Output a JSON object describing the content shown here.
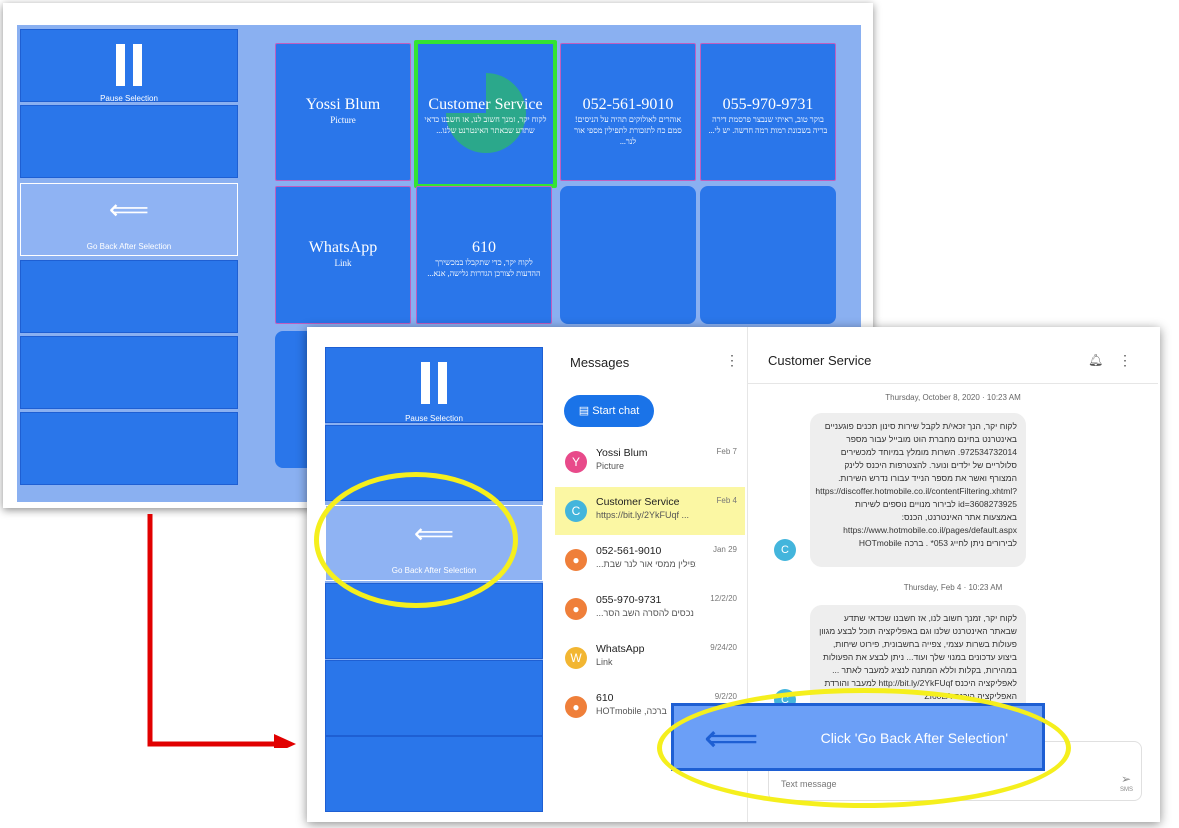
{
  "window1": {
    "sidebar": {
      "pause_label": "Pause Selection",
      "goback_label": "Go Back After Selection"
    },
    "tiles": [
      {
        "title": "Yossi Blum",
        "sub": "Picture",
        "heb": ""
      },
      {
        "title": "Customer Service",
        "sub": "",
        "heb": "לקוח יקר, זמנך חשוב לנו, אז חשבנו כדאי שתדע שבאתר האינטרנט שלנו..."
      },
      {
        "title": "052-561-9010",
        "sub": "",
        "heb": "אוהרים לאולוקים תהיה על הניסים! סמם כח לתזכורת לתפילין מספי אור לנר..."
      },
      {
        "title": "055-970-9731",
        "sub": "",
        "heb": "בוקר טוב, ראיתי שנבצר פרסמת דירה בריה בשכונת רמות רמה חדשה. יש לי..."
      },
      {
        "title": "WhatsApp",
        "sub": "Link",
        "heb": ""
      },
      {
        "title": "610",
        "sub": "",
        "heb": "לקוח יקר, כדי שתקבלו במכשירך ההדעות לצורכן הגדרות גלישה, אנא..."
      }
    ]
  },
  "window2": {
    "sidebar": {
      "pause_label": "Pause Selection",
      "goback_label": "Go Back After Selection"
    },
    "messages": {
      "header": "Messages",
      "start_chat": "Start chat",
      "rows": [
        {
          "initial": "Y",
          "name": "Yossi Blum",
          "preview": "Picture",
          "date": "Feb 7",
          "color": "#e84a8a"
        },
        {
          "initial": "C",
          "name": "Customer Service",
          "preview": "https://bit.ly/2YkFUqf ...",
          "date": "Feb 4",
          "color": "#43b5dc"
        },
        {
          "initial": "",
          "name": "052-561-9010",
          "preview": "...תפילין ממסי אור לנר שבת",
          "date": "Jan 29",
          "color": "#ef7f3a"
        },
        {
          "initial": "",
          "name": "055-970-9731",
          "preview": "...נכסים להסרה השב הסר",
          "date": "12/2/20",
          "color": "#ef7f3a"
        },
        {
          "initial": "W",
          "name": "WhatsApp",
          "preview": "Link",
          "date": "9/24/20",
          "color": "#f2b632"
        },
        {
          "initial": "",
          "name": "610",
          "preview": "HOTmobile ,ברכה",
          "date": "9/2/20",
          "color": "#ef7f3a"
        }
      ]
    },
    "conversation": {
      "title": "Customer Service",
      "timestamp1": "Thursday, October 8, 2020 · 10:23 AM",
      "bubble1": "לקוח יקר, הנך זכאי/ת לקבל שירות סינון תכנים פוגעניים באינטרנט בחינם מחברת הוט מובייל עבור מספר 972534732014. השרות מומלץ במיוחד למכשירים סלולריים של ילדים ונוער. להצטרפות היכנס ללינק המצורף ואשר את מספר הנייד עבורו נדרש השירות. https://discoffer.hotmobile.co.il/contentFiltering.xhtml?id=3608273925 לבירור מנויים נוספים לשירות באמצעות אתר האינטרנט, הכנס: https://www.hotmobile.co.il/pages/default.aspx לבירורים ניתן לחייג 053* . ברכה HOTmobile",
      "timestamp2": "Thursday, Feb 4 · 10:23 AM",
      "bubble2": "לקוח יקר, זמנך חשוב לנו, אז חשבנו שכדאי שתדע שבאתר האינטרנט שלנו וגם באפליקציה תוכל לבצע מגוון פעולות בשרות עצמי, צפייה בחשבונית, פירוט שיחות, ביצוע עדכונים במנוי שלך ועוד... ניתן לבצע את הפעולות במהירות, בקלות וללא המתנה לנציג למעבר לאתר ... לאפליקציה היכנס http://bit.ly/2YkFUqf למעבר והורדת האפליקציה היכנס ZI60LA",
      "compose_placeholder": "Text message",
      "sms_label": "SMS"
    },
    "tooltip": {
      "text": "Click 'Go Back After Selection'"
    }
  },
  "colors": {
    "tile_blue": "#2a76ea",
    "panel_light": "#8ab0f1",
    "selection_green": "#33e433",
    "highlight_yellow": "#f5ef1d",
    "arrow_red": "#e10000"
  },
  "icons": {
    "pause": "pause-icon",
    "back_arrow": "arrow-left-icon",
    "chat": "chat-icon",
    "bell": "bell-icon",
    "menu": "kebab-menu-icon",
    "send": "send-icon"
  }
}
